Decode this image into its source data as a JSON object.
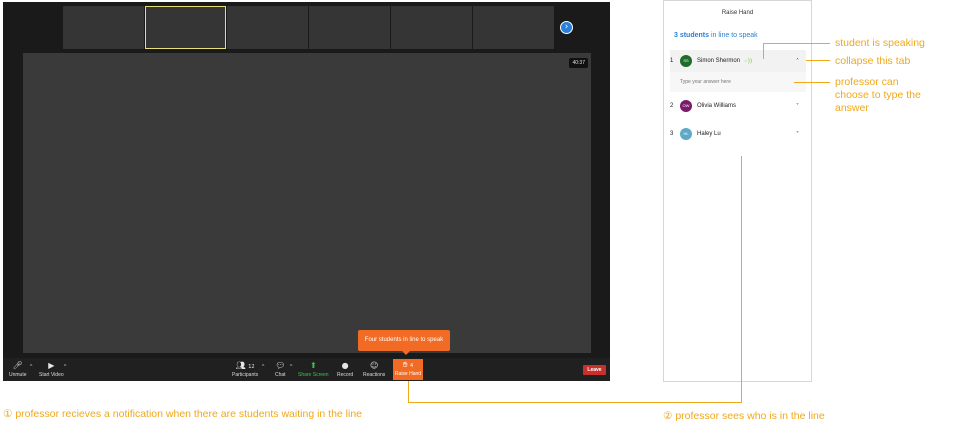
{
  "meeting": {
    "timer": "40:37",
    "next_icon": "chevron-right-icon",
    "toolbar": {
      "unmute": "Unmute",
      "start_video": "Start Video",
      "participants": "Participants",
      "participants_count": "12",
      "chat": "Chat",
      "share_screen": "Share Screen",
      "record": "Record",
      "reactions": "Reactions",
      "raise_hand": "Raise Hand",
      "raise_hand_count": "4",
      "leave": "Leave"
    },
    "tooltip": "Four students in line to speak"
  },
  "panel": {
    "title": "Raise Hand",
    "count_prefix": "3 students",
    "count_suffix": " in line to speak",
    "answer_placeholder": "Type your answer here",
    "students": [
      {
        "num": "1",
        "initials": "SS",
        "name": "Simon Shermon",
        "color": "#1f6b2a"
      },
      {
        "num": "2",
        "initials": "OW",
        "name": "Olivia Williams",
        "color": "#7b1a6b"
      },
      {
        "num": "3",
        "initials": "HL",
        "name": "Haley Lu",
        "color": "#5fa8c8"
      }
    ]
  },
  "annotations": {
    "speaking": "student is speaking",
    "collapse": "collapse this tab",
    "type_answer_1": "professor can",
    "type_answer_2": "choose to type the",
    "type_answer_3": "answer",
    "notification": "① professor recieves a notification when there are students waiting in the line",
    "sees_line": "② professor sees who is in the line"
  },
  "colors": {
    "accent": "#f26b24",
    "annotation": "#f0a81b",
    "link": "#2b7fd8"
  }
}
